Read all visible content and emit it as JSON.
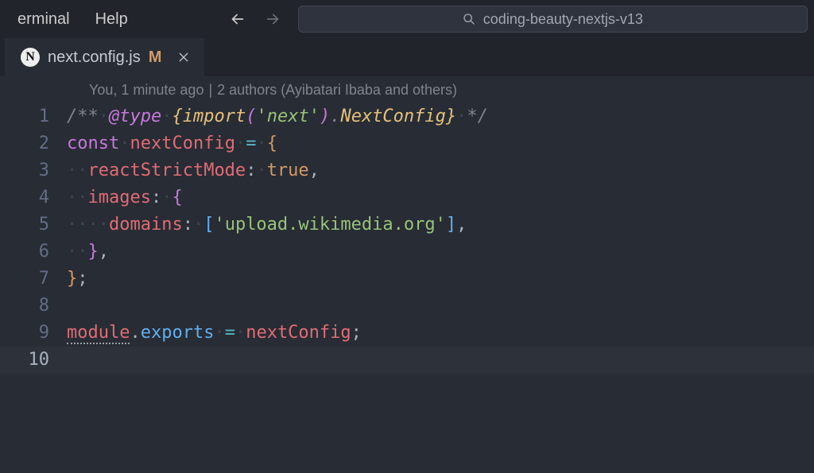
{
  "menu": {
    "terminal": "erminal",
    "help": "Help"
  },
  "search": {
    "placeholder": "coding-beauty-nextjs-v13"
  },
  "tab": {
    "icon_letter": "N",
    "filename": "next.config.js",
    "modified_indicator": "M"
  },
  "codelens": {
    "who": "You, 1 minute ago",
    "authors": "2 authors (Ayibatari Ibaba and others)"
  },
  "code": {
    "l1": {
      "c_open": "/**",
      "ws1": "·",
      "at": "@",
      "tag": "type",
      "ws2": "·",
      "brace_o": "{",
      "imp": "import",
      "paren_o": "(",
      "str": "'next'",
      "paren_c": ")",
      "dot": ".",
      "typ": "NextConfig",
      "brace_c": "}",
      "ws3": "·",
      "c_close": "*/"
    },
    "l2": {
      "kw": "const",
      "ws1": "·",
      "name": "nextConfig",
      "ws2": "·",
      "eq": "=",
      "ws3": "·",
      "brace": "{"
    },
    "l3": {
      "indent": "··",
      "key": "reactStrictMode",
      "colon": ":",
      "ws": "·",
      "val": "true",
      "comma": ","
    },
    "l4": {
      "indent": "··",
      "key": "images",
      "colon": ":",
      "ws": "·",
      "brace": "{"
    },
    "l5": {
      "indent": "····",
      "key": "domains",
      "colon": ":",
      "ws": "·",
      "lb": "[",
      "str": "'upload.wikimedia.org'",
      "rb": "]",
      "comma": ","
    },
    "l6": {
      "indent": "··",
      "brace": "}",
      "comma": ","
    },
    "l7": {
      "brace": "}",
      "semi": ";"
    },
    "l9": {
      "mod": "module",
      "dot": ".",
      "exp": "exports",
      "ws1": "·",
      "eq": "=",
      "ws2": "·",
      "name": "nextConfig",
      "semi": ";"
    }
  },
  "line_numbers": [
    "1",
    "2",
    "3",
    "4",
    "5",
    "6",
    "7",
    "8",
    "9",
    "10"
  ]
}
